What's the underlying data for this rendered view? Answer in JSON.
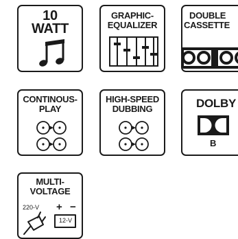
{
  "features": [
    {
      "id": "watt",
      "title_line1": "10",
      "title_line2": "WATT",
      "icon": "music-note-icon"
    },
    {
      "id": "equalizer",
      "title_line1": "GRAPHIC-",
      "title_line2": "EQUALIZER",
      "icon": "equalizer-sliders-icon"
    },
    {
      "id": "cassette",
      "title_line1": "DOUBLE",
      "title_line2": "CASSETTE",
      "icon": "cassette-reels-icon"
    },
    {
      "id": "continous",
      "title_line1": "CONTINOUS-",
      "title_line2": "PLAY",
      "icon": "continuous-play-reels-icon"
    },
    {
      "id": "dubbing",
      "title_line1": "HIGH-SPEED",
      "title_line2": "DUBBING",
      "icon": "dubbing-reels-icon"
    },
    {
      "id": "dolby",
      "title_line1": "DOLBY",
      "title_line2": "B",
      "icon": "dolby-double-d-icon"
    },
    {
      "id": "voltage",
      "title_line1": "MULTI-",
      "title_line2": "VOLTAGE",
      "icon": "power-plug-battery-icon",
      "voltage_ac": "220-V",
      "voltage_dc": "12-V",
      "plus_sign": "+",
      "minus_sign": "−"
    }
  ]
}
